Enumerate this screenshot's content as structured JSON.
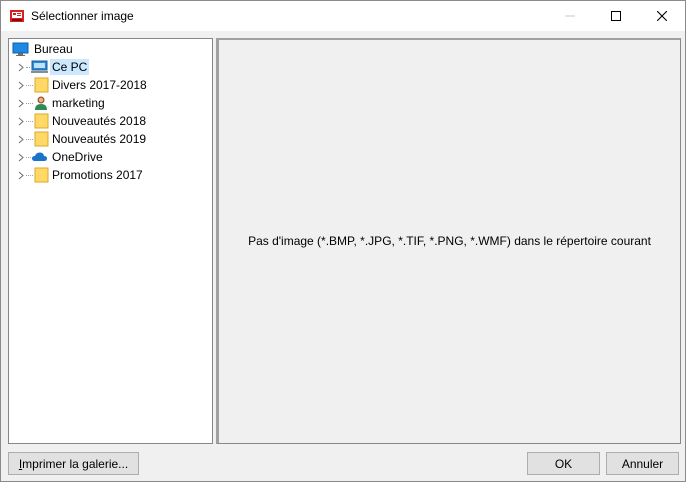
{
  "window": {
    "title": "Sélectionner image",
    "controls": {
      "minimize_icon": "minimize-icon",
      "maximize_icon": "maximize-icon",
      "close_icon": "close-icon"
    }
  },
  "tree": {
    "root": {
      "label": "Bureau",
      "icon": "desktop-icon"
    },
    "items": [
      {
        "label": "Ce PC",
        "icon": "computer-icon",
        "selected": true
      },
      {
        "label": "Divers 2017-2018",
        "icon": "folder-icon"
      },
      {
        "label": "marketing",
        "icon": "user-icon"
      },
      {
        "label": "Nouveautés 2018",
        "icon": "folder-icon"
      },
      {
        "label": "Nouveautés 2019",
        "icon": "folder-icon"
      },
      {
        "label": "OneDrive",
        "icon": "cloud-icon"
      },
      {
        "label": "Promotions 2017",
        "icon": "folder-icon"
      }
    ]
  },
  "preview": {
    "message": "Pas d'image (*.BMP, *.JPG, *.TIF, *.PNG, *.WMF) dans le répertoire courant"
  },
  "buttons": {
    "print_gallery_first": "I",
    "print_gallery_rest": "mprimer la galerie...",
    "ok": "OK",
    "cancel": "Annuler"
  },
  "colors": {
    "selection": "#cce8ff",
    "folder": "#ffd866",
    "cloud": "#1a73c8",
    "computer": "#2b88d8"
  }
}
